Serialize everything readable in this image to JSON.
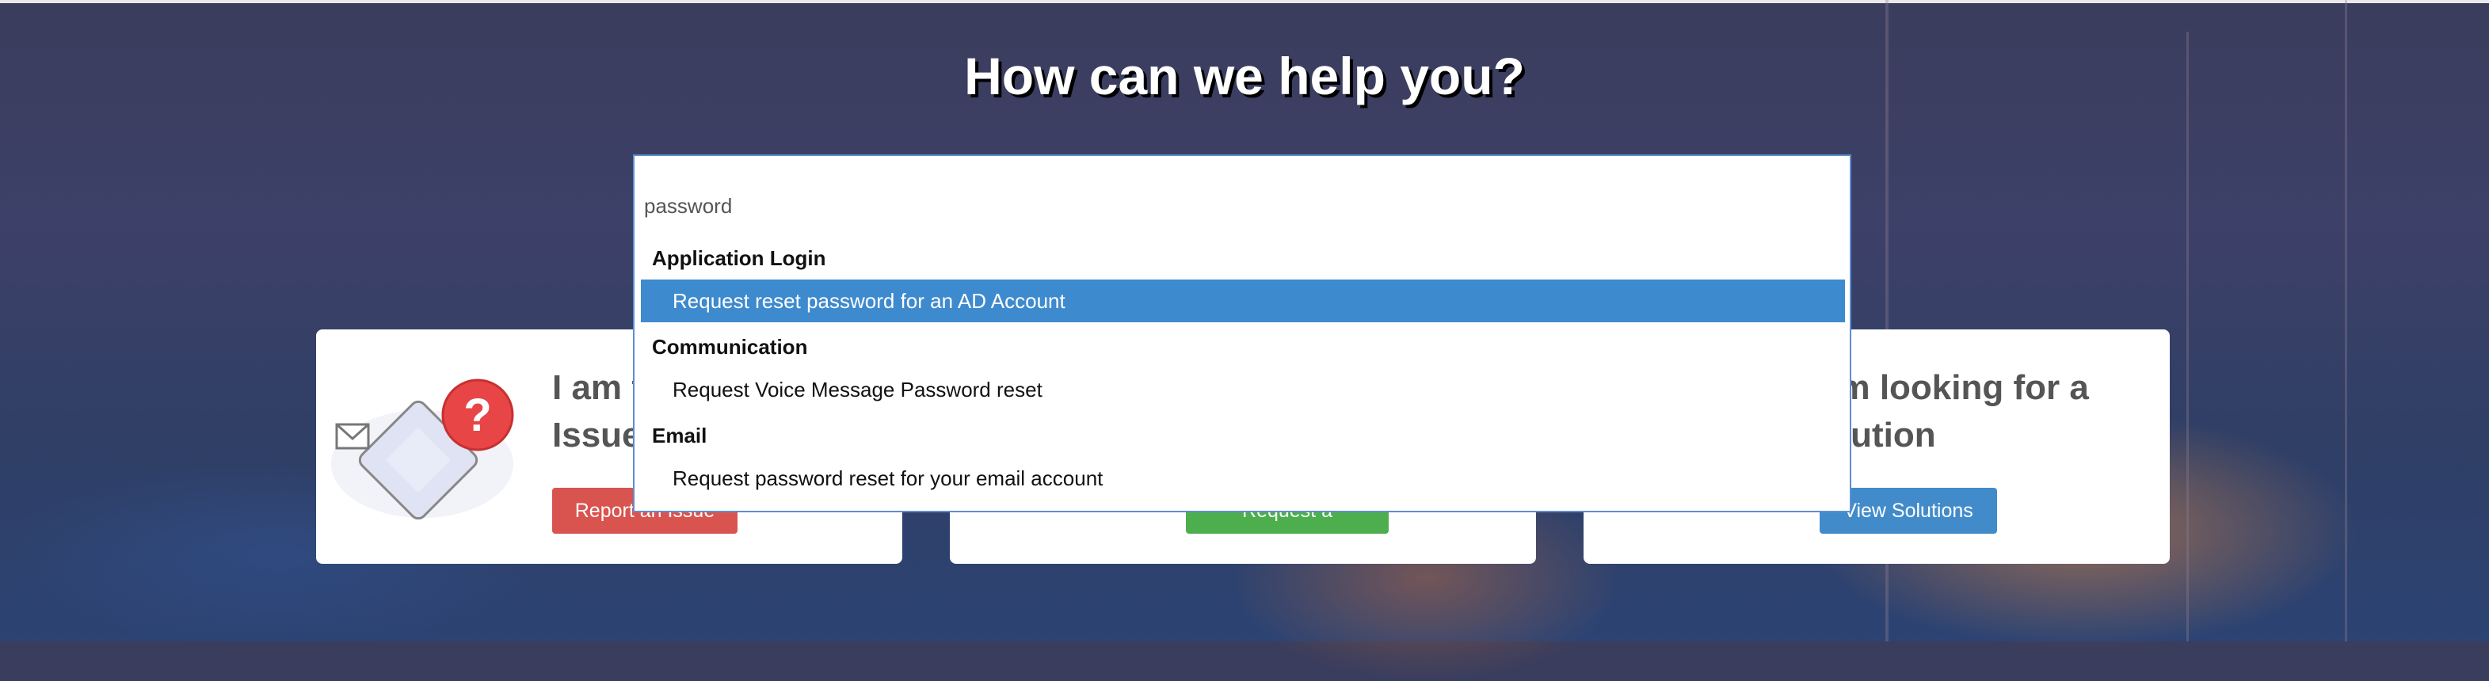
{
  "hero": {
    "title": "How can we help you?"
  },
  "search": {
    "value": "password",
    "groups": [
      {
        "label": "Application Login",
        "items": [
          {
            "label": "Request reset password for an AD Account",
            "selected": true
          }
        ]
      },
      {
        "label": "Communication",
        "items": [
          {
            "label": "Request Voice Message Password reset",
            "selected": false
          }
        ]
      },
      {
        "label": "Email",
        "items": [
          {
            "label": "Request password reset for your email account",
            "selected": false
          }
        ]
      }
    ]
  },
  "cards": [
    {
      "title_line1": "I am f",
      "title_line2": "Issue",
      "button": "Report an Issue"
    },
    {
      "button": "Request a Service"
    },
    {
      "title_line1": "am looking for a",
      "title_line2": "olution",
      "button": "View Solutions"
    }
  ],
  "colors": {
    "selected_row": "#3d8ace",
    "report_button": "#d9534f",
    "request_button": "#4cae4c",
    "solutions_button": "#428bca"
  }
}
